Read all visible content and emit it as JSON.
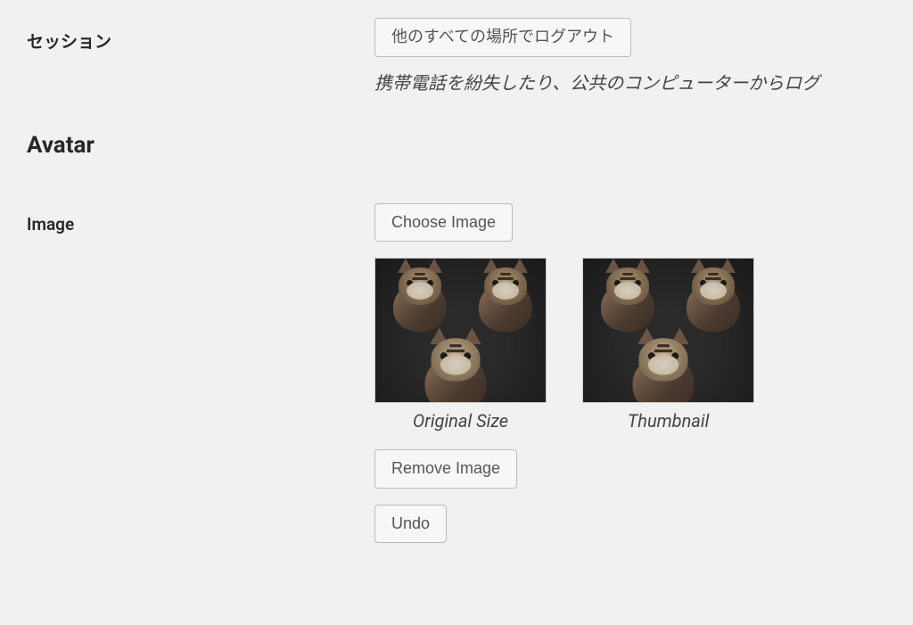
{
  "session": {
    "label": "セッション",
    "logout_button": "他のすべての場所でログアウト",
    "description": "携帯電話を紛失したり、公共のコンピューターからログ"
  },
  "avatar": {
    "heading": "Avatar",
    "image_label": "Image",
    "choose_button": "Choose Image",
    "original_caption": "Original Size",
    "thumbnail_caption": "Thumbnail",
    "remove_button": "Remove Image",
    "undo_button": "Undo"
  }
}
